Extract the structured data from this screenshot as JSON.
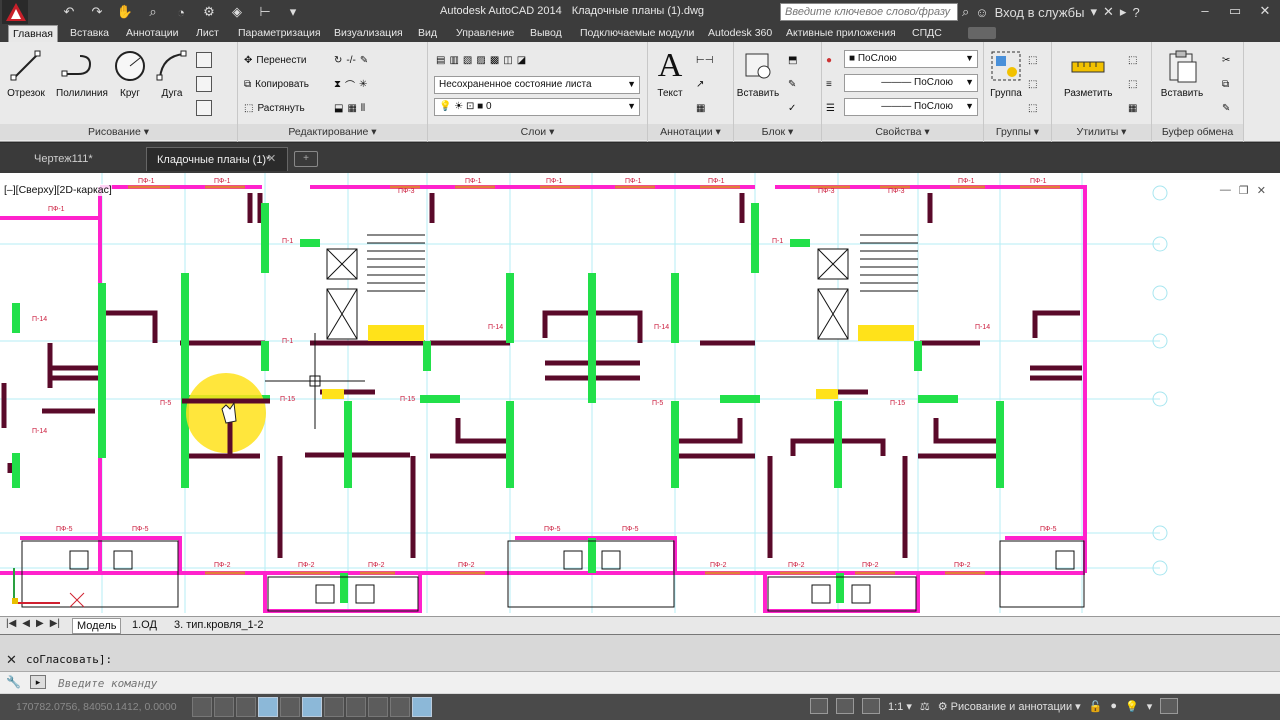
{
  "app": {
    "title": "Autodesk AutoCAD 2014",
    "file": "Кладочные планы (1).dwg",
    "search_placeholder": "Введите ключевое слово/фразу",
    "signin_label": "Вход в службы",
    "brand_color": "#c8202a"
  },
  "ribbon_tabs": [
    "Главная",
    "Вставка",
    "Аннотации",
    "Лист",
    "Параметризация",
    "Визуализация",
    "Вид",
    "Управление",
    "Вывод",
    "Подключаемые модули",
    "Autodesk 360",
    "Активные приложения",
    "СПДС"
  ],
  "active_tab_index": 0,
  "panels": {
    "draw": {
      "footer": "Рисование",
      "tools": [
        "Отрезок",
        "Полилиния",
        "Круг",
        "Дуга"
      ]
    },
    "modify": {
      "footer": "Редактирование",
      "move": "Перенести",
      "copy": "Копировать",
      "stretch": "Растянуть"
    },
    "layers": {
      "footer": "Слои",
      "state": "Несохраненное состояние листа",
      "current_layer": "0"
    },
    "annotations": {
      "footer": "Аннотации",
      "text": "Текст"
    },
    "block": {
      "footer": "Блок",
      "insert": "Вставить"
    },
    "properties": {
      "footer": "Свойства",
      "color": "ПоСлою",
      "linetype": "ПоСлою",
      "lineweight": "ПоСлою"
    },
    "groups": {
      "footer": "Группы",
      "group": "Группа"
    },
    "utilities": {
      "footer": "Утилиты",
      "measure": "Разметить"
    },
    "clipboard": {
      "footer": "Буфер обмена",
      "paste": "Вставить"
    }
  },
  "doc_tabs": [
    {
      "label": "Чертеж111*",
      "active": false
    },
    {
      "label": "Кладочные планы (1)*",
      "active": true
    }
  ],
  "viewport": {
    "label": "[–][Сверху][2D-каркас]"
  },
  "drawing_labels": {
    "pf1": "ПФ-1",
    "pf2": "ПФ-2",
    "pf3": "ПФ-3",
    "pf5": "ПФ-5",
    "p14": "П-14",
    "p15": "П-15",
    "p1": "П-1",
    "p5": "П-5"
  },
  "layout_tabs": [
    "Модель",
    "1.ОД",
    "3. тип.кровля_1-2"
  ],
  "active_layout_index": 0,
  "command": {
    "history": "соГласовать]:",
    "placeholder": "Введите команду"
  },
  "status": {
    "coords": "170782.0756, 84050.1412, 0.0000",
    "scale": "1:1",
    "workspace": "Рисование и аннотации"
  },
  "colors": {
    "wall_dark": "#5a0a2a",
    "wall_green": "#22e04a",
    "wall_magenta": "#ff22cc",
    "grid_cyan": "#a8ecf4",
    "highlight_yellow": "#ffe21a"
  }
}
